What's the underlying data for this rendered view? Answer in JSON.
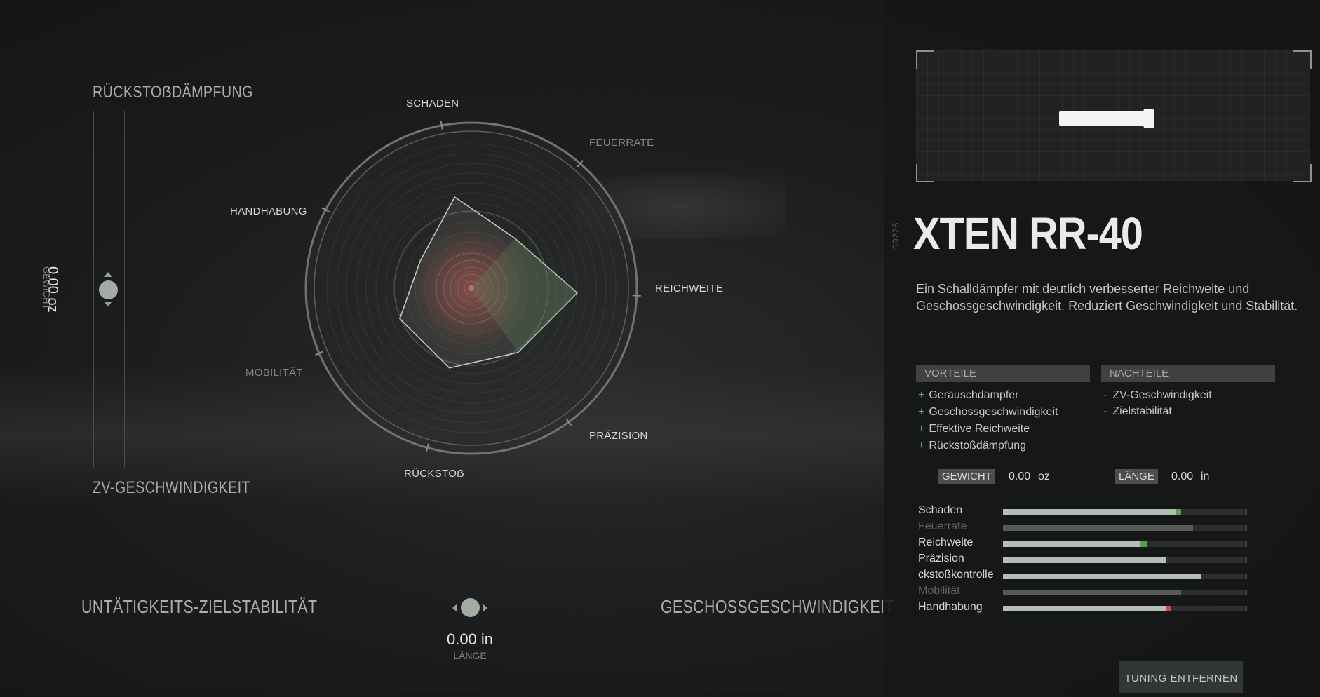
{
  "left_slider": {
    "top_label": "RÜCKSTOẞDÄMPFUNG",
    "bottom_label": "ZV-GESCHWINDIGKEIT",
    "value": "0.00 oz",
    "caption": "GEWICHT"
  },
  "radar": {
    "axes": [
      "SCHADEN",
      "FEUERRATE",
      "REICHWEITE",
      "PRÄZISION",
      "RÜCKSTOẞ",
      "MOBILITÄT",
      "HANDHABUNG"
    ],
    "dim_axes": [
      "FEUERRATE",
      "MOBILITÄT"
    ],
    "values": [
      0.56,
      0.4,
      0.64,
      0.48,
      0.5,
      0.47,
      0.35
    ],
    "colors": {
      "polygon": "#5f8a58",
      "center": "#c8564f"
    }
  },
  "bottom_slider": {
    "left_label": "UNTÄTIGKEITS-ZIELSTABILITÄT",
    "right_label": "GESCHOSSGESCHWINDIGKEIT",
    "value": "0.00 in",
    "caption": "LÄNGE"
  },
  "item": {
    "code": "90225",
    "title": "XTEN RR-40",
    "description": "Ein Schalldämpfer mit deutlich verbesserter Reichweite und Geschossgeschwindigkeit. Reduziert Geschwindigkeit und Stabilität."
  },
  "pros": {
    "header": "VORTEILE",
    "items": [
      "Geräuschdämpfer",
      "Geschossgeschwindigkeit",
      "Effektive Reichweite",
      "Rückstoßdämpfung"
    ]
  },
  "cons": {
    "header": "NACHTEILE",
    "items": [
      "ZV-Geschwindigkeit",
      "Zielstabilität"
    ]
  },
  "specs": {
    "weight_label": "GEWICHT",
    "weight_value": "0.00",
    "weight_unit": "oz",
    "length_label": "LÄNGE",
    "length_value": "0.00",
    "length_unit": "in"
  },
  "stats": [
    {
      "name": "Schaden",
      "value": 0.71,
      "delta": 0.02,
      "delta_color": "#4fa34c",
      "dim": false
    },
    {
      "name": "Feuerrate",
      "value": 0.78,
      "delta": 0,
      "delta_color": "",
      "dim": true
    },
    {
      "name": "Reichweite",
      "value": 0.56,
      "delta": 0.03,
      "delta_color": "#4fa34c",
      "dim": false
    },
    {
      "name": "Präzision",
      "value": 0.67,
      "delta": 0,
      "delta_color": "",
      "dim": false
    },
    {
      "name": "ckstoßkontrolle",
      "value": 0.81,
      "delta": 0,
      "delta_color": "",
      "dim": false
    },
    {
      "name": "Mobilität",
      "value": 0.73,
      "delta": 0,
      "delta_color": "",
      "dim": true
    },
    {
      "name": "Handhabung",
      "value": 0.69,
      "delta": -0.02,
      "delta_color": "#d04a44",
      "dim": false
    }
  ],
  "remove_button": "TUNING ENTFERNEN"
}
